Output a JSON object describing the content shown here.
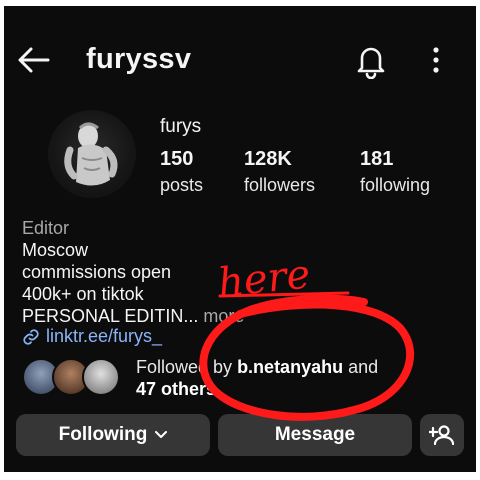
{
  "topbar": {
    "username": "furyssv",
    "back_icon": "arrow-left-icon",
    "notify_icon": "bell-icon",
    "more_icon": "more-vertical-icon"
  },
  "profile": {
    "display_name": "furys",
    "stats": [
      {
        "value": "150",
        "label": "posts"
      },
      {
        "value": "128K",
        "label": "followers"
      },
      {
        "value": "181",
        "label": "following"
      }
    ],
    "category": "Editor",
    "bio_lines": [
      "Moscow",
      "commissions open",
      "400k+ on tiktok",
      "PERSONAL EDITIN"
    ],
    "bio_ellipsis": "...",
    "more_label": "more",
    "link_text": "linktr.ee/furys_"
  },
  "mutuals": {
    "prefix": "Followed by ",
    "name": "b.netanyahu",
    "suffix": " and",
    "others": "47 others"
  },
  "actions": {
    "following_label": "Following",
    "message_label": "Message",
    "add_user_icon": "add-user-icon"
  },
  "annotation": {
    "text": "here",
    "color": "#ff1a1a"
  }
}
